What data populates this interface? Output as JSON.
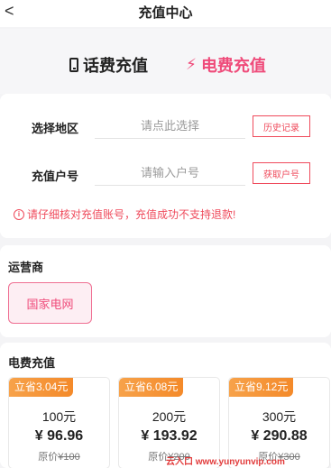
{
  "header": {
    "back_glyph": "<",
    "title": "充值中心"
  },
  "tabs": [
    {
      "label": "话费充值",
      "icon": "phone-icon",
      "active": false
    },
    {
      "label": "电费充值",
      "icon": "lightning-icon",
      "active": true
    }
  ],
  "form": {
    "region": {
      "label": "选择地区",
      "placeholder": "请点此选择",
      "button": "历史记录"
    },
    "account": {
      "label": "充值户号",
      "placeholder": "请输入户号",
      "button": "获取户号"
    },
    "notice": "请仔细核对充值账号，充值成功不支持退款!",
    "notice_icon": "i"
  },
  "operator": {
    "section_title": "运营商",
    "selected": "国家电网"
  },
  "recharge": {
    "section_title": "电费充值",
    "currency": "¥",
    "original_prefix": "原价",
    "packages": [
      {
        "badge": "立省3.04元",
        "amount": "100元",
        "price": "96.96",
        "original": "100"
      },
      {
        "badge": "立省6.08元",
        "amount": "200元",
        "price": "193.92",
        "original": "200"
      },
      {
        "badge": "立省9.12元",
        "amount": "300元",
        "price": "290.88",
        "original": "300"
      }
    ]
  },
  "watermark": "云入口 www.yunyunvip.com",
  "colors": {
    "accent": "#ef4b7a",
    "warning": "#ef4b5c",
    "badge": "#f48a2a",
    "background": "#f4f4f6"
  }
}
